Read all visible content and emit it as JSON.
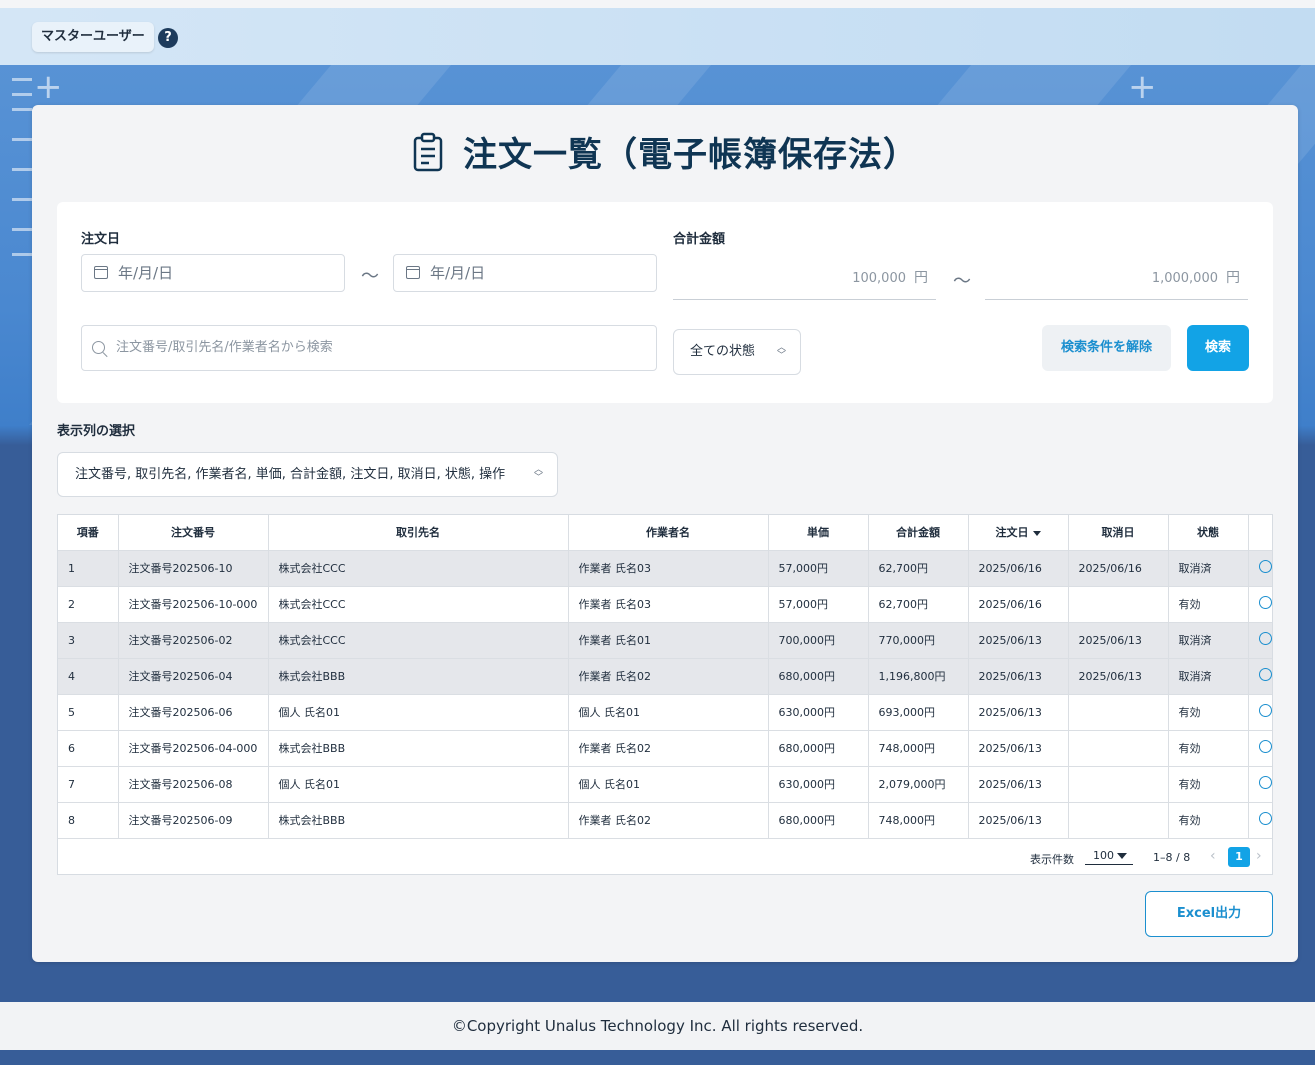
{
  "header": {
    "user_label": "マスターユーザー",
    "help_glyph": "?"
  },
  "page": {
    "title": "注文一覧（電子帳簿保存法）"
  },
  "filters": {
    "order_date_label": "注文日",
    "date_from_placeholder": "年/月/日",
    "date_to_placeholder": "年/月/日",
    "tilde": "〜",
    "total_label": "合計金額",
    "amount_min_placeholder": "100,000",
    "amount_max_placeholder": "1,000,000",
    "currency_unit": "円",
    "search_placeholder": "注文番号/取引先名/作業者名から検索",
    "status_selected": "全ての状態",
    "clear_button": "検索条件を解除",
    "search_button": "検索"
  },
  "columns_selector": {
    "label": "表示列の選択",
    "value": "注文番号, 取引先名, 作業者名, 単価, 合計金額, 注文日, 取消日, 状態, 操作"
  },
  "table": {
    "headers": [
      "項番",
      "注文番号",
      "取引先名",
      "作業者名",
      "単価",
      "合計金額",
      "注文日",
      "取消日",
      "状態",
      ""
    ],
    "rows": [
      {
        "no": "1",
        "order": "注文番号202506-10",
        "client": "株式会社CCC",
        "worker": "作業者 氏名03",
        "unit": "57,000円",
        "total": "62,700円",
        "date": "2025/06/16",
        "cancel": "2025/06/16",
        "status": "取消済"
      },
      {
        "no": "2",
        "order": "注文番号202506-10-000",
        "client": "株式会社CCC",
        "worker": "作業者 氏名03",
        "unit": "57,000円",
        "total": "62,700円",
        "date": "2025/06/16",
        "cancel": "",
        "status": "有効"
      },
      {
        "no": "3",
        "order": "注文番号202506-02",
        "client": "株式会社CCC",
        "worker": "作業者 氏名01",
        "unit": "700,000円",
        "total": "770,000円",
        "date": "2025/06/13",
        "cancel": "2025/06/13",
        "status": "取消済"
      },
      {
        "no": "4",
        "order": "注文番号202506-04",
        "client": "株式会社BBB",
        "worker": "作業者 氏名02",
        "unit": "680,000円",
        "total": "1,196,800円",
        "date": "2025/06/13",
        "cancel": "2025/06/13",
        "status": "取消済"
      },
      {
        "no": "5",
        "order": "注文番号202506-06",
        "client": "個人 氏名01",
        "worker": "個人 氏名01",
        "unit": "630,000円",
        "total": "693,000円",
        "date": "2025/06/13",
        "cancel": "",
        "status": "有効"
      },
      {
        "no": "6",
        "order": "注文番号202506-04-000",
        "client": "株式会社BBB",
        "worker": "作業者 氏名02",
        "unit": "680,000円",
        "total": "748,000円",
        "date": "2025/06/13",
        "cancel": "",
        "status": "有効"
      },
      {
        "no": "7",
        "order": "注文番号202506-08",
        "client": "個人 氏名01",
        "worker": "個人 氏名01",
        "unit": "630,000円",
        "total": "2,079,000円",
        "date": "2025/06/13",
        "cancel": "",
        "status": "有効"
      },
      {
        "no": "8",
        "order": "注文番号202506-09",
        "client": "株式会社BBB",
        "worker": "作業者 氏名02",
        "unit": "680,000円",
        "total": "748,000円",
        "date": "2025/06/13",
        "cancel": "",
        "status": "有効"
      }
    ]
  },
  "pagination": {
    "per_page_label": "表示件数",
    "per_page_value": "100",
    "range": "1–8 / 8",
    "current_page": "1",
    "prev_glyph": "‹",
    "next_glyph": "›"
  },
  "actions": {
    "excel_button": "Excel出力"
  },
  "footer": {
    "copyright": "©Copyright Unalus Technology Inc. All rights reserved."
  },
  "colors": {
    "accent": "#12a3e6",
    "title": "#0f3553",
    "cancelled_row": "#e5e7eb"
  },
  "icons": {
    "title": "clipboard-document-icon",
    "calendar": "calendar-icon",
    "search": "search-icon",
    "operation": "action-circle-icon",
    "help": "question-circle-icon"
  }
}
